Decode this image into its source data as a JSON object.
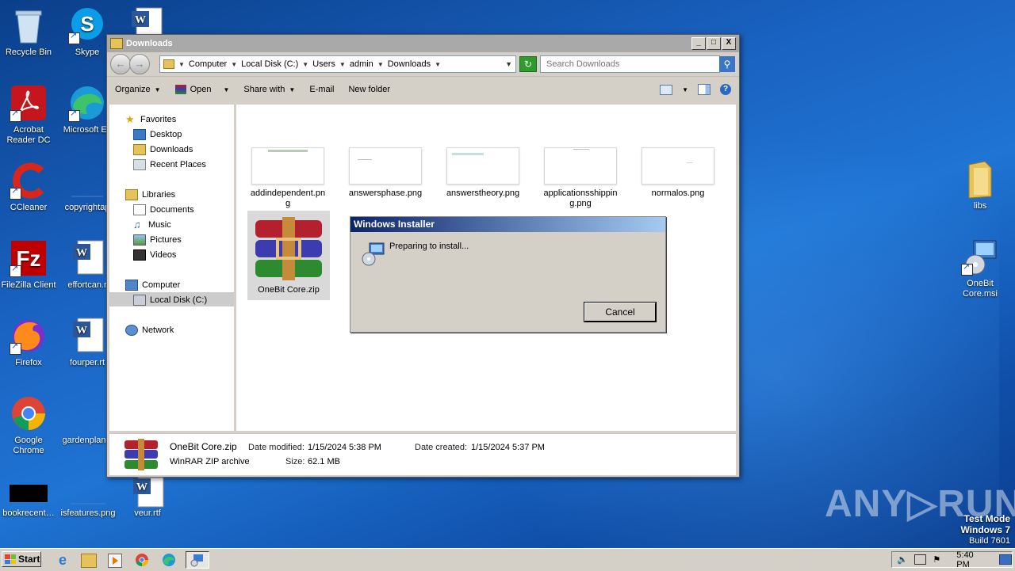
{
  "desktop": {
    "icons": [
      {
        "label": "Recycle Bin"
      },
      {
        "label": "Skype"
      },
      {
        "label": "Acrobat Reader DC"
      },
      {
        "label": "Microsoft Ec"
      },
      {
        "label": "CCleaner"
      },
      {
        "label": "copyrightap"
      },
      {
        "label": "FileZilla Client"
      },
      {
        "label": "effortcan.r"
      },
      {
        "label": "Firefox"
      },
      {
        "label": "fourper.rt"
      },
      {
        "label": "Google Chrome"
      },
      {
        "label": "gardenplan"
      },
      {
        "label": "bookrecent…"
      },
      {
        "label": "isfeatures.png"
      },
      {
        "label": "veur.rtf"
      },
      {
        "label": "libs"
      },
      {
        "label": "OneBit Core.msi"
      }
    ]
  },
  "window": {
    "title": "Downloads",
    "buttons": {
      "minimize": "_",
      "maximize": "□",
      "close": "X"
    },
    "address": {
      "crumbs": [
        "Computer",
        "Local Disk (C:)",
        "Users",
        "admin",
        "Downloads"
      ]
    },
    "search": {
      "placeholder": "Search Downloads"
    },
    "toolbar": {
      "organize": "Organize",
      "open": "Open",
      "share_with": "Share with",
      "email": "E-mail",
      "new_folder": "New folder"
    },
    "nav": {
      "favorites": "Favorites",
      "desktop": "Desktop",
      "downloads": "Downloads",
      "recent": "Recent Places",
      "libraries": "Libraries",
      "documents": "Documents",
      "music": "Music",
      "pictures": "Pictures",
      "videos": "Videos",
      "computer": "Computer",
      "local_disk": "Local Disk (C:)",
      "network": "Network"
    },
    "files": [
      {
        "name": "addindependent.png"
      },
      {
        "name": "answersphase.png"
      },
      {
        "name": "answerstheory.png"
      },
      {
        "name": "applicationsshipping.png"
      },
      {
        "name": "normalos.png"
      },
      {
        "name": "OneBit Core.zip"
      }
    ],
    "details": {
      "name": "OneBit Core.zip",
      "type": "WinRAR ZIP archive",
      "modified_label": "Date modified:",
      "modified": "1/15/2024 5:38 PM",
      "created_label": "Date created:",
      "created": "1/15/2024 5:37 PM",
      "size_label": "Size:",
      "size": "62.1 MB"
    }
  },
  "dialog": {
    "title": "Windows Installer",
    "message": "Preparing to install...",
    "cancel": "Cancel"
  },
  "taskbar": {
    "start": "Start",
    "clock": "5:40 PM"
  },
  "watermark": "ANY▷RUN",
  "test_mode": {
    "line1": "Test Mode",
    "line2": "Windows 7",
    "line3": "Build 7601"
  },
  "colors": {
    "dialog_title_start": "#0a246a",
    "dialog_title_end": "#a6caf0",
    "desktop": "#1a63c2"
  }
}
